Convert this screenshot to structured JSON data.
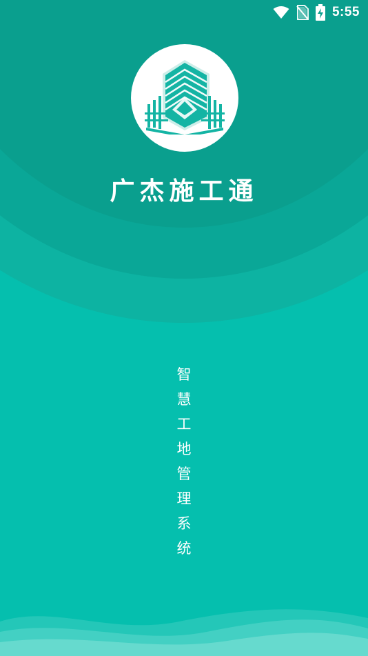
{
  "status_bar": {
    "time": "5:55",
    "icons": [
      "wifi-icon",
      "no-sim-icon",
      "battery-charging-icon"
    ]
  },
  "app": {
    "logo_icon": "building-icon",
    "name": "广杰施工通",
    "tagline_chars": [
      "智",
      "慧",
      "工",
      "地",
      "管",
      "理",
      "系",
      "统"
    ]
  },
  "colors": {
    "background": "#05bfae",
    "header_dark": "#0a9f8e",
    "accent": "#14b4a4",
    "text": "#ffffff"
  }
}
